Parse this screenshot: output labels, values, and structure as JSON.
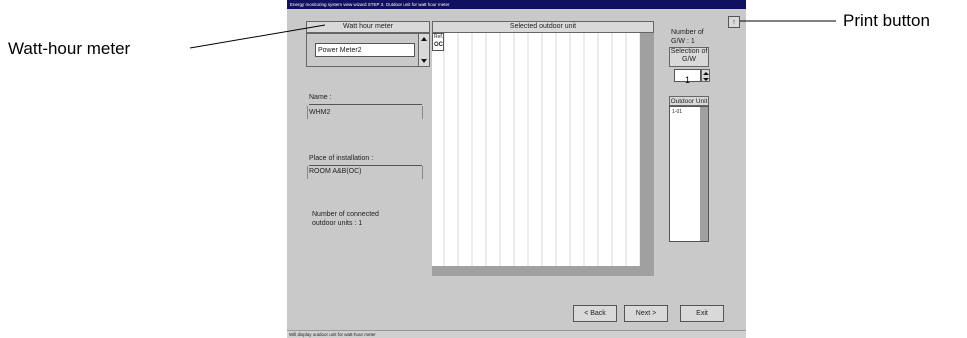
{
  "window": {
    "title": "Energy monitoring system view wizard   STEP 3. Outdoor unit for watt hour meter",
    "status_bar": "Will display outdoor unit for watt-hour meter"
  },
  "left_panel": {
    "header": "Watt hour meter",
    "selected_meter": "Power Meter2",
    "name_label": "Name :",
    "name_value": "WHM2",
    "place_label": "Place of installation :",
    "place_value": "ROOM A&B(OC)",
    "connected_line1": "Number of connected",
    "connected_line2": "outdoor units :   1"
  },
  "center_panel": {
    "header": "Selected outdoor unit",
    "corner_label": "Ref.",
    "unit_label": "OC"
  },
  "right_panel": {
    "gw_count_line1": "Number of",
    "gw_count_line2": "G/W : 1",
    "gw_select_line1": "Selection of",
    "gw_select_line2": "G/W",
    "gw_value": "1",
    "outdoor_header": "Outdoor Unit",
    "outdoor_item": "1-01"
  },
  "buttons": {
    "print": "↑",
    "back": "< Back",
    "next": "Next >",
    "exit": "Exit"
  },
  "callouts": {
    "left": "Watt-hour meter",
    "right": "Print button"
  }
}
